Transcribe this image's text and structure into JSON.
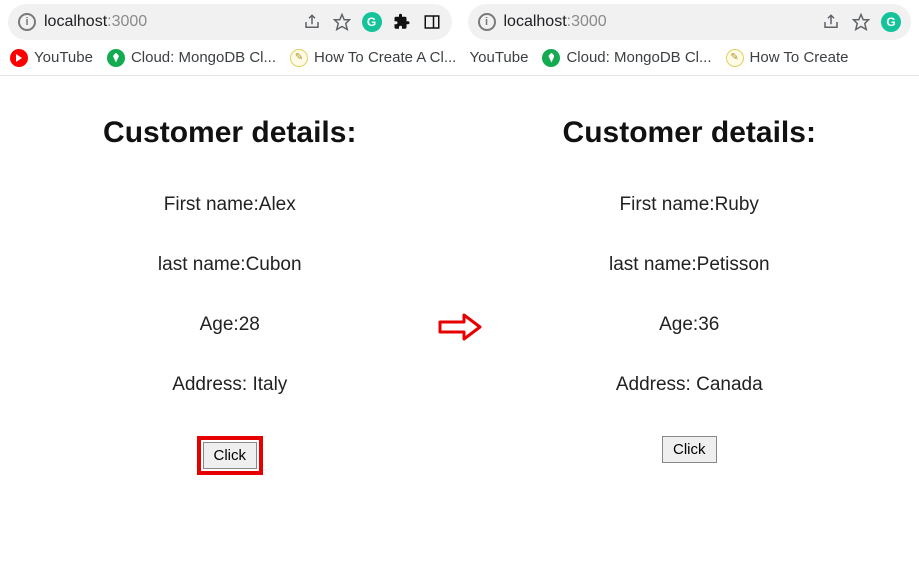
{
  "browser": {
    "host": "localhost",
    "port": ":3000"
  },
  "bookmarks": {
    "youtube": "YouTube",
    "mongo": "Cloud: MongoDB Cl...",
    "howto": "How To Create A Cl...",
    "howto_trunc": "How To Create"
  },
  "left": {
    "title": "Customer details:",
    "first_name_label": "First name:",
    "first_name": "Alex",
    "last_name_label": "last name:",
    "last_name": "Cubon",
    "age_label": "Age:",
    "age": "28",
    "address_label": "Address: ",
    "address": "Italy",
    "button": "Click"
  },
  "right": {
    "title": "Customer details:",
    "first_name_label": "First name:",
    "first_name": "Ruby",
    "last_name_label": "last name:",
    "last_name": "Petisson",
    "age_label": "Age:",
    "age": "36",
    "address_label": "Address: ",
    "address": "Canada",
    "button": "Click"
  }
}
